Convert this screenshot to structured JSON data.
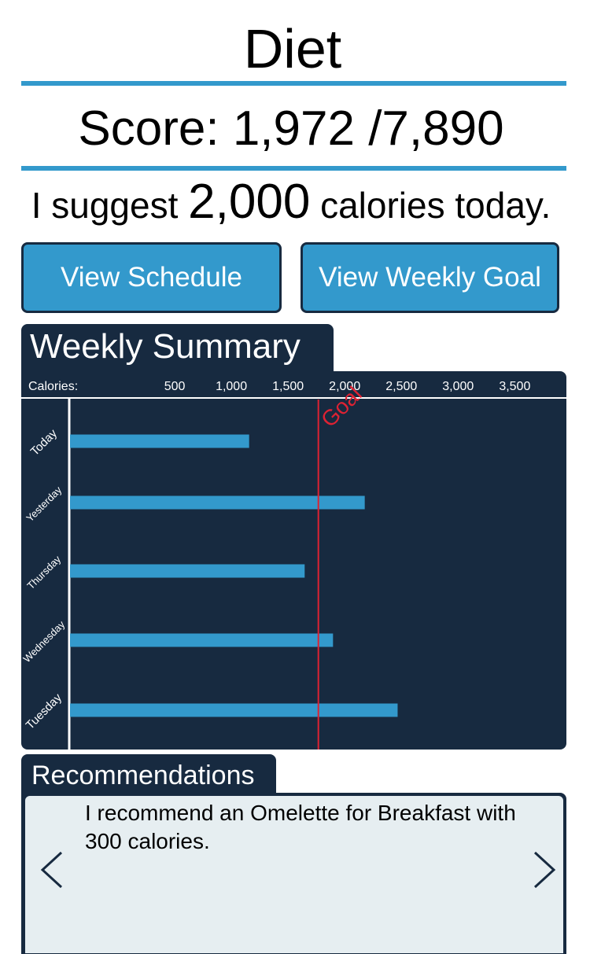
{
  "header": {
    "title": "Diet",
    "score": "Score: 1,972 /7,890",
    "suggest_prefix": "I suggest ",
    "suggest_value": "2,000",
    "suggest_suffix": " calories today."
  },
  "buttons": {
    "view_schedule": "View Schedule",
    "view_weekly_goal": "View Weekly Goal"
  },
  "weekly_summary": {
    "title": "Weekly Summary"
  },
  "recommendations": {
    "title": "Recommendations",
    "text": "I recommend an Omelette for Breakfast with 300 calories.",
    "prev_icon": "chevron-left-icon",
    "next_icon": "chevron-right-icon"
  },
  "colors": {
    "accent": "#3399cc",
    "dark": "#172a40",
    "goal": "#dd2233",
    "panel_light": "#e6eef1"
  },
  "chart_data": {
    "type": "bar",
    "orientation": "horizontal",
    "xlabel": "Calories:",
    "tick_values": [
      500,
      1000,
      1500,
      2000,
      2500,
      3000,
      3500
    ],
    "tick_labels": [
      "500",
      "1,000",
      "1,500",
      "2,000",
      "2,500",
      "3,000",
      "3,500"
    ],
    "categories": [
      "Today",
      "Yesterday",
      "Thursday",
      "Wednesday",
      "Tuesday"
    ],
    "values": [
      1580,
      2600,
      2070,
      2320,
      2890
    ],
    "goal": {
      "label": "Goal",
      "value": 2000
    }
  }
}
